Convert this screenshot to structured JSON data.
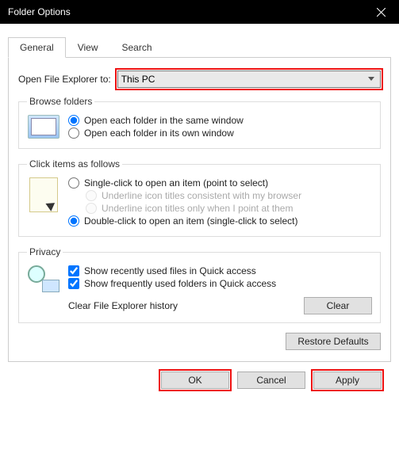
{
  "window": {
    "title": "Folder Options"
  },
  "tabs": {
    "general": "General",
    "view": "View",
    "search": "Search"
  },
  "open_to": {
    "label": "Open File Explorer to:",
    "value": "This PC"
  },
  "browse": {
    "legend": "Browse folders",
    "same": "Open each folder in the same window",
    "own": "Open each folder in its own window"
  },
  "click": {
    "legend": "Click items as follows",
    "single": "Single-click to open an item (point to select)",
    "u_browser": "Underline icon titles consistent with my browser",
    "u_point": "Underline icon titles only when I point at them",
    "double": "Double-click to open an item (single-click to select)"
  },
  "privacy": {
    "legend": "Privacy",
    "recent": "Show recently used files in Quick access",
    "frequent": "Show frequently used folders in Quick access",
    "clear_label": "Clear File Explorer history",
    "clear_btn": "Clear"
  },
  "restore": "Restore Defaults",
  "buttons": {
    "ok": "OK",
    "cancel": "Cancel",
    "apply": "Apply"
  }
}
